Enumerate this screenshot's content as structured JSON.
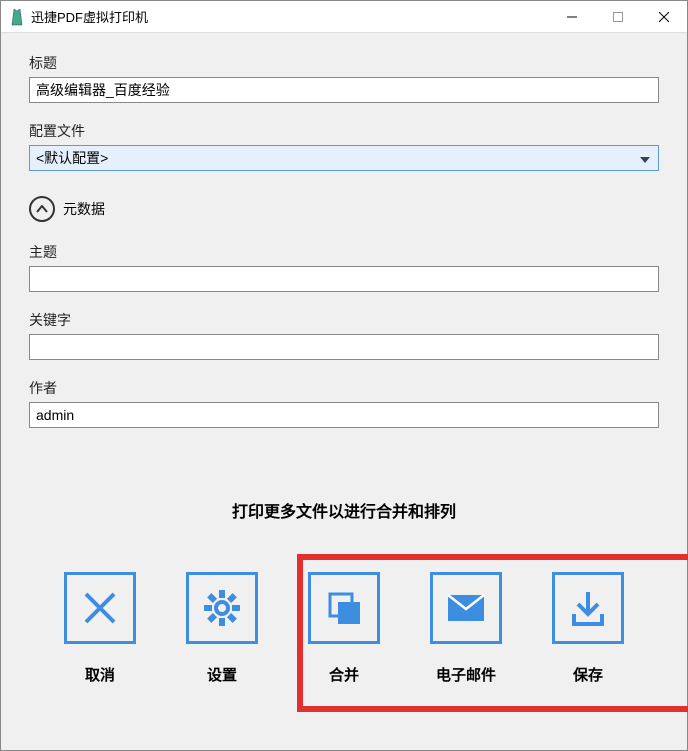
{
  "window": {
    "title": "迅捷PDF虚拟打印机"
  },
  "fields": {
    "title": {
      "label": "标题",
      "value": "高级编辑器_百度经验"
    },
    "config": {
      "label": "配置文件",
      "value": "<默认配置>"
    },
    "metadata_header": "元数据",
    "subject": {
      "label": "主题",
      "value": ""
    },
    "keywords": {
      "label": "关键字",
      "value": ""
    },
    "author": {
      "label": "作者",
      "value": "admin"
    }
  },
  "instruction": "打印更多文件以进行合并和排列",
  "buttons": {
    "cancel": "取消",
    "settings": "设置",
    "merge": "合并",
    "email": "电子邮件",
    "save": "保存"
  }
}
